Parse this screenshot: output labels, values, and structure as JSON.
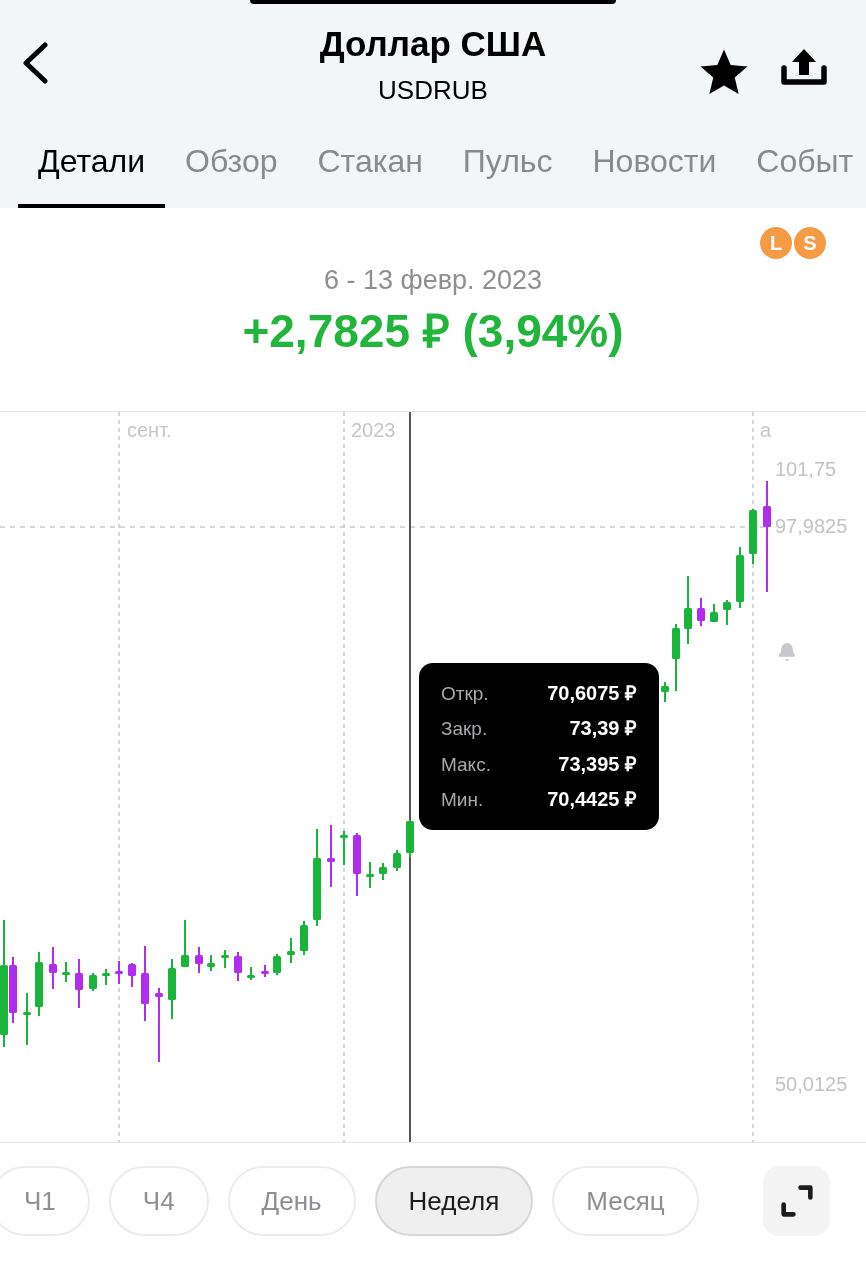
{
  "header": {
    "title": "Доллар США",
    "subtitle": "USDRUB",
    "favorited": true
  },
  "tabs": [
    {
      "label": "Детали",
      "selected": true
    },
    {
      "label": "Обзор",
      "selected": false
    },
    {
      "label": "Стакан",
      "selected": false
    },
    {
      "label": "Пульс",
      "selected": false
    },
    {
      "label": "Новости",
      "selected": false
    },
    {
      "label": "Событ",
      "selected": false
    }
  ],
  "badge": {
    "letters": [
      "L",
      "S"
    ]
  },
  "summary": {
    "period": "6 - 13 февр. 2023",
    "change": "+2,7825 ₽ (3,94%)"
  },
  "chart": {
    "x_labels": [
      "сент.",
      "2023",
      "а"
    ],
    "price_labels": [
      "101,75",
      "97,9825",
      "50,0125"
    ],
    "tooltip": [
      {
        "label": "Откр.",
        "value": "70,6075 ₽"
      },
      {
        "label": "Закр.",
        "value": "73,39 ₽"
      },
      {
        "label": "Макс.",
        "value": "73,395 ₽"
      },
      {
        "label": "Мин.",
        "value": "70,4425 ₽"
      }
    ]
  },
  "intervals": [
    {
      "label": "Ч1",
      "selected": false
    },
    {
      "label": "Ч4",
      "selected": false
    },
    {
      "label": "День",
      "selected": false
    },
    {
      "label": "Неделя",
      "selected": true
    },
    {
      "label": "Месяц",
      "selected": false
    }
  ]
}
